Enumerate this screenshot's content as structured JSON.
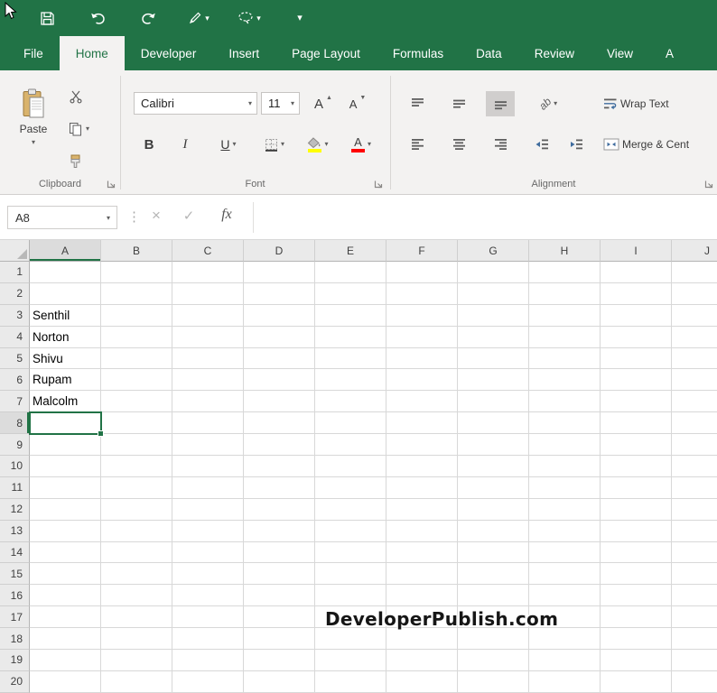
{
  "colors": {
    "excel_green": "#217346",
    "ribbon_bg": "#f3f2f1",
    "highlight_yellow": "#ffff00",
    "font_red": "#ff0000"
  },
  "icons": {
    "dropdown": "▾",
    "cancel": "×",
    "enter": "✓",
    "dots_separator": "⋮",
    "up_arrow": "▲",
    "down_arrow": "▼"
  },
  "tabs": [
    {
      "label": "File"
    },
    {
      "label": "Home",
      "active": true
    },
    {
      "label": "Developer"
    },
    {
      "label": "Insert"
    },
    {
      "label": "Page Layout"
    },
    {
      "label": "Formulas"
    },
    {
      "label": "Data"
    },
    {
      "label": "Review"
    },
    {
      "label": "View"
    },
    {
      "label": "A",
      "partial": true
    }
  ],
  "ribbon": {
    "clipboard": {
      "group_label": "Clipboard",
      "paste_label": "Paste"
    },
    "font": {
      "group_label": "Font",
      "font_name": "Calibri",
      "font_size": "11",
      "bold_label": "B",
      "italic_label": "I",
      "underline_label": "U",
      "grow_font_label": "A",
      "shrink_font_label": "A",
      "font_color_label": "A"
    },
    "alignment": {
      "group_label": "Alignment",
      "orientation_label": "ab",
      "wrap_text_label": "Wrap Text",
      "merge_center_label": "Merge & Cent"
    }
  },
  "formula_bar": {
    "name_box_value": "A8",
    "fx_label": "fx",
    "formula_value": ""
  },
  "grid": {
    "column_headers": [
      "A",
      "B",
      "C",
      "D",
      "E",
      "F",
      "G",
      "H",
      "I",
      "J"
    ],
    "row_headers": [
      "1",
      "2",
      "3",
      "4",
      "5",
      "6",
      "7",
      "8",
      "9",
      "10",
      "11",
      "12",
      "13",
      "14",
      "15",
      "16",
      "17",
      "18",
      "19",
      "20"
    ],
    "cells": {
      "A3": "Senthil",
      "A4": "Norton",
      "A5": "Shivu",
      "A6": "Rupam",
      "A7": "Malcolm"
    },
    "selected_cell": "A8"
  },
  "watermark_text": "DeveloperPublish.com"
}
